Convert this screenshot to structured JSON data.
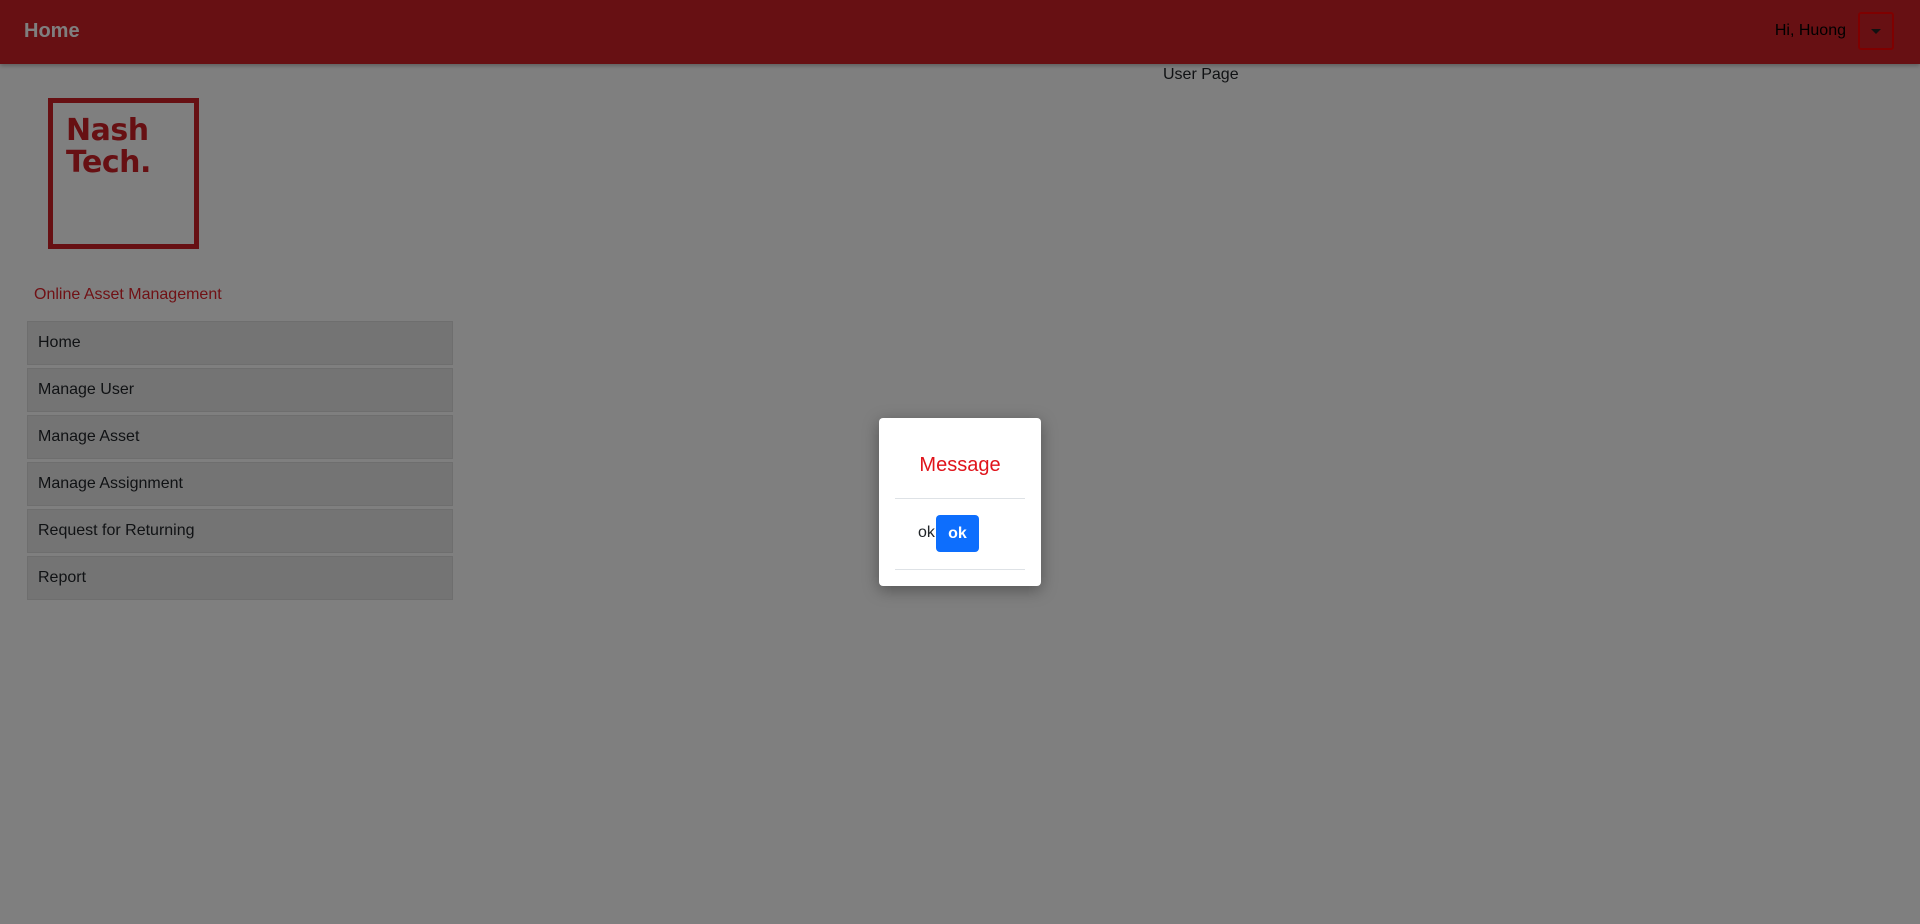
{
  "navbar": {
    "title": "Home",
    "greeting": "Hi, Huong",
    "dropdown_icon": "caret-down-icon"
  },
  "main": {
    "heading": "User Page"
  },
  "logo": {
    "line1": "Nash",
    "line2": "Tech."
  },
  "sidebar": {
    "app_name": "Online Asset Management",
    "items": [
      {
        "label": "Home"
      },
      {
        "label": "Manage User"
      },
      {
        "label": "Manage Asset"
      },
      {
        "label": "Manage Assignment"
      },
      {
        "label": "Request for Returning"
      },
      {
        "label": "Report"
      }
    ]
  },
  "modal": {
    "title": "Message",
    "body_text": "ok",
    "ok_button_label": "ok"
  },
  "colors": {
    "brand_red": "#cf2127",
    "primary_blue": "#0d6efd",
    "modal_title": "#e0141b"
  }
}
